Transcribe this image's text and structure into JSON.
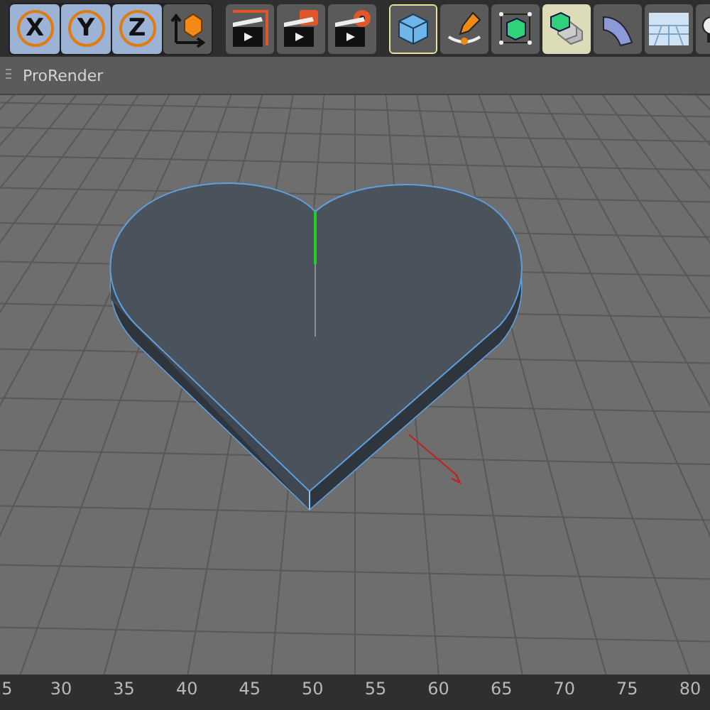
{
  "toolbar": {
    "axis_buttons": [
      {
        "label": "X",
        "selected": true
      },
      {
        "label": "Y",
        "selected": true
      },
      {
        "label": "Z",
        "selected": true
      }
    ],
    "tools": [
      {
        "kind": "coordinates",
        "selected": false
      },
      {
        "kind": "render-view",
        "selected": false
      },
      {
        "kind": "render-picture",
        "selected": false
      },
      {
        "kind": "render-settings",
        "selected": false
      },
      {
        "kind": "cube",
        "selected": true
      },
      {
        "kind": "pen",
        "selected": false
      },
      {
        "kind": "deformer",
        "selected": false
      },
      {
        "kind": "array",
        "selected": true
      },
      {
        "kind": "bend",
        "selected": false
      },
      {
        "kind": "floor",
        "selected": false
      },
      {
        "kind": "light",
        "selected": false
      }
    ]
  },
  "menu_bar": {
    "items": [
      "ProRender"
    ]
  },
  "timeline": {
    "labels": [
      "5",
      "30",
      "35",
      "40",
      "45",
      "50",
      "55",
      "60",
      "65",
      "70",
      "75",
      "80"
    ]
  }
}
